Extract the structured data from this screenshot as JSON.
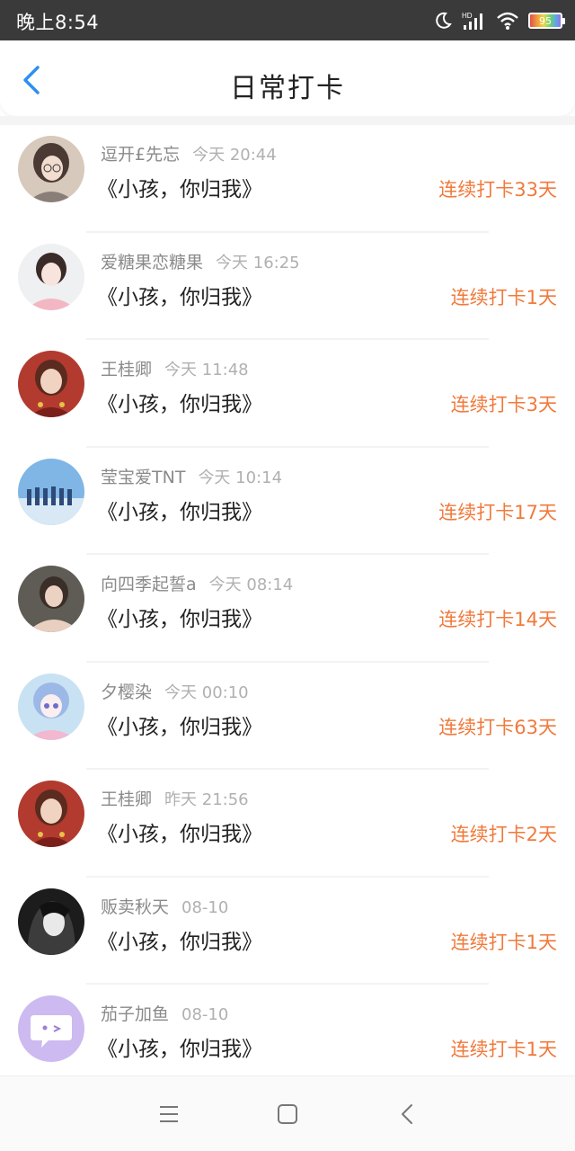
{
  "status_bar": {
    "time": "晚上8:54",
    "battery": "95",
    "icons": [
      "moon-icon",
      "hd-signal-icon",
      "wifi-icon",
      "battery-icon"
    ]
  },
  "header": {
    "title": "日常打卡",
    "back_icon": "chevron-left-icon"
  },
  "colors": {
    "accent_blue": "#2f8ff0",
    "streak_orange": "#f07a3c",
    "status_bar_bg": "#3a3a3a"
  },
  "checkins": [
    {
      "user": "逗开£先忘",
      "time": "今天 20:44",
      "book": "《小孩，你归我》",
      "streak": "连续打卡33天"
    },
    {
      "user": "爱糖果恋糖果",
      "time": "今天 16:25",
      "book": "《小孩，你归我》",
      "streak": "连续打卡1天"
    },
    {
      "user": "王桂卿",
      "time": "今天 11:48",
      "book": "《小孩，你归我》",
      "streak": "连续打卡3天"
    },
    {
      "user": "莹宝爱TNT",
      "time": "今天 10:14",
      "book": "《小孩，你归我》",
      "streak": "连续打卡17天"
    },
    {
      "user": "向四季起誓a",
      "time": "今天 08:14",
      "book": "《小孩，你归我》",
      "streak": "连续打卡14天"
    },
    {
      "user": "夕樱染",
      "time": "今天 00:10",
      "book": "《小孩，你归我》",
      "streak": "连续打卡63天"
    },
    {
      "user": "王桂卿",
      "time": "昨天 21:56",
      "book": "《小孩，你归我》",
      "streak": "连续打卡2天"
    },
    {
      "user": "贩卖秋天",
      "time": "08-10",
      "book": "《小孩，你归我》",
      "streak": "连续打卡1天"
    },
    {
      "user": "茄子加鱼",
      "time": "08-10",
      "book": "《小孩，你归我》",
      "streak": "连续打卡1天"
    }
  ],
  "bottom_nav": [
    "menu-icon",
    "home-icon",
    "back-icon"
  ]
}
